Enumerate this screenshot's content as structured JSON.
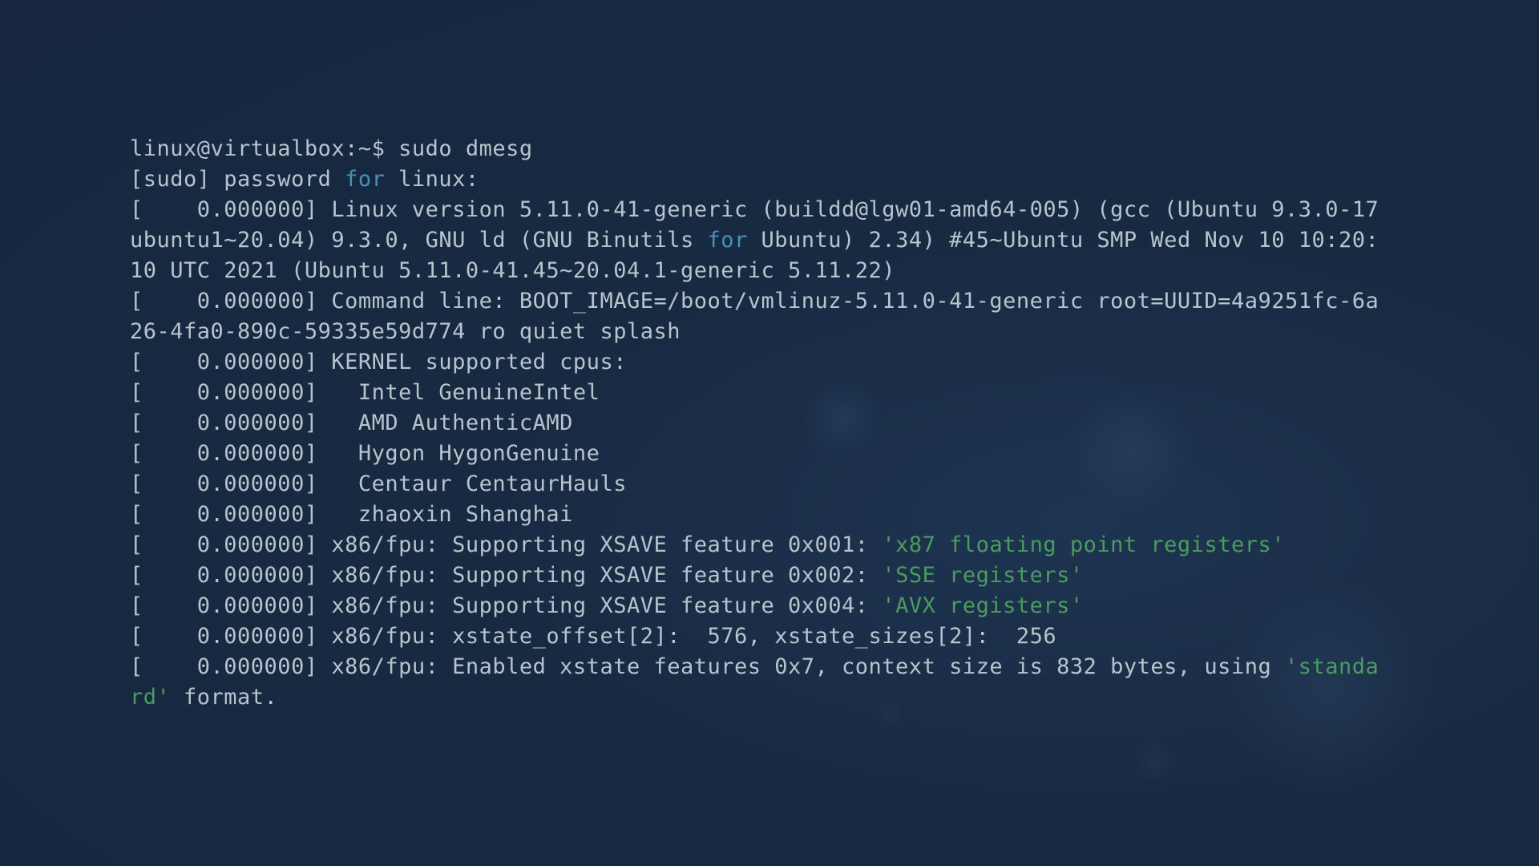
{
  "terminal": {
    "segments": [
      {
        "text": "linux@virtualbox:~$ sudo dmesg\n",
        "cls": ""
      },
      {
        "text": "[sudo] password ",
        "cls": ""
      },
      {
        "text": "for",
        "cls": "kw-for"
      },
      {
        "text": " linux:\n",
        "cls": ""
      },
      {
        "text": "[    0.000000] Linux version 5.11.0-41-generic (buildd@lgw01-amd64-005) (gcc (Ubuntu 9.3.0-17ubuntu1~20.04) 9.3.0, GNU ld (GNU Binutils ",
        "cls": ""
      },
      {
        "text": "for",
        "cls": "kw-for"
      },
      {
        "text": " Ubuntu) 2.34) #45~Ubuntu SMP Wed Nov 10 10:20:10 UTC 2021 (Ubuntu 5.11.0-41.45~20.04.1-generic 5.11.22)\n",
        "cls": ""
      },
      {
        "text": "[    0.000000] Command line: BOOT_IMAGE=/boot/vmlinuz-5.11.0-41-generic root=UUID=4a9251fc-6a26-4fa0-890c-59335e59d774 ro quiet splash\n",
        "cls": ""
      },
      {
        "text": "[    0.000000] KERNEL supported cpus:\n",
        "cls": ""
      },
      {
        "text": "[    0.000000]   Intel GenuineIntel\n",
        "cls": ""
      },
      {
        "text": "[    0.000000]   AMD AuthenticAMD\n",
        "cls": ""
      },
      {
        "text": "[    0.000000]   Hygon HygonGenuine\n",
        "cls": ""
      },
      {
        "text": "[    0.000000]   Centaur CentaurHauls\n",
        "cls": ""
      },
      {
        "text": "[    0.000000]   zhaoxin Shanghai\n",
        "cls": ""
      },
      {
        "text": "[    0.000000] x86/fpu: Supporting XSAVE feature 0x001: ",
        "cls": ""
      },
      {
        "text": "'x87 floating point registers'",
        "cls": "str-green"
      },
      {
        "text": "\n",
        "cls": ""
      },
      {
        "text": "[    0.000000] x86/fpu: Supporting XSAVE feature 0x002: ",
        "cls": ""
      },
      {
        "text": "'SSE registers'",
        "cls": "str-green"
      },
      {
        "text": "\n",
        "cls": ""
      },
      {
        "text": "[    0.000000] x86/fpu: Supporting XSAVE feature 0x004: ",
        "cls": ""
      },
      {
        "text": "'AVX registers'",
        "cls": "str-green"
      },
      {
        "text": "\n",
        "cls": ""
      },
      {
        "text": "[    0.000000] x86/fpu: xstate_offset[2]:  576, xstate_sizes[2]:  256\n",
        "cls": ""
      },
      {
        "text": "[    0.000000] x86/fpu: Enabled xstate features 0x7, context size is 832 bytes, using ",
        "cls": ""
      },
      {
        "text": "'standard'",
        "cls": "str-green"
      },
      {
        "text": " format.\n",
        "cls": ""
      }
    ]
  },
  "colors": {
    "background": "#182a42",
    "text": "#b8c4cc",
    "keyword": "#4a8fb5",
    "string": "#4a9c5e"
  }
}
